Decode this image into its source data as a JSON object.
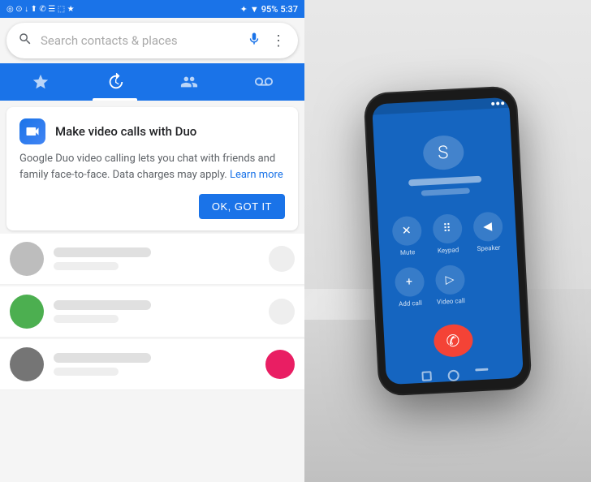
{
  "status_bar": {
    "battery": "95%",
    "time": "5:37",
    "signal": "▲"
  },
  "search": {
    "placeholder": "Search contacts & places"
  },
  "tabs": [
    {
      "id": "favorites",
      "label": "Favorites",
      "active": false
    },
    {
      "id": "recent",
      "label": "Recent",
      "active": true
    },
    {
      "id": "contacts",
      "label": "Contacts",
      "active": false
    },
    {
      "id": "voicemail",
      "label": "Voicemail",
      "active": false
    }
  ],
  "duo_card": {
    "title": "Make video calls with Duo",
    "description": "Google Duo video calling lets you chat with friends and family face-to-face. Data charges may apply.",
    "learn_more": "Learn more",
    "button": "OK, GOT IT"
  },
  "contacts": [
    {
      "id": 1,
      "avatar_type": "gray"
    },
    {
      "id": 2,
      "avatar_type": "green"
    },
    {
      "id": 3,
      "avatar_type": "dark-gray",
      "has_action": true
    }
  ],
  "right_panel": {
    "phone_screen": {
      "caller_letter": "S",
      "controls": [
        {
          "icon": "✕",
          "label": "Mute"
        },
        {
          "icon": "⠿",
          "label": "Keypad"
        },
        {
          "icon": "▶",
          "label": "Speaker"
        },
        {
          "icon": "+",
          "label": "Add call"
        },
        {
          "icon": "▷",
          "label": "Video call"
        }
      ]
    }
  }
}
